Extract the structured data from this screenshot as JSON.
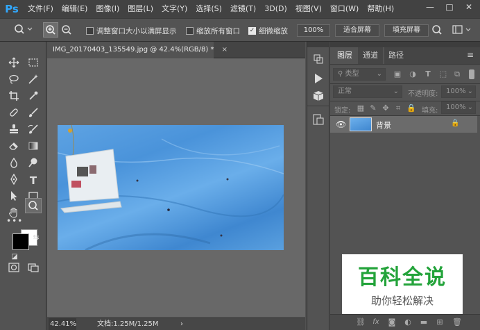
{
  "app": {
    "logo": "Ps"
  },
  "menu": [
    "文件(F)",
    "编辑(E)",
    "图像(I)",
    "图层(L)",
    "文字(Y)",
    "选择(S)",
    "滤镜(T)",
    "3D(D)",
    "视图(V)",
    "窗口(W)",
    "帮助(H)"
  ],
  "window_controls": {
    "minimize": "—",
    "restore": "□",
    "close": "✕"
  },
  "options": {
    "resize_windows": "调整窗口大小以满屏显示",
    "resize_checked": false,
    "zoom_all": "缩放所有窗口",
    "zoom_all_checked": false,
    "scrubby": "细微缩放",
    "scrubby_checked": true,
    "percent": "100%",
    "fit_screen": "适合屏幕",
    "fill_screen": "填充屏幕"
  },
  "document": {
    "tab_title": "IMG_20170403_135549.jpg @ 42.4%(RGB/8) *",
    "close": "×"
  },
  "status": {
    "zoom": "42.41%",
    "doc_info": "文档:1.25M/1.25M",
    "arrow": "›"
  },
  "layers_panel": {
    "tabs": [
      "图层",
      "通道",
      "路径"
    ],
    "filter_kind": "类型",
    "blend_mode": "正常",
    "opacity_label": "不透明度:",
    "opacity_value": "100%",
    "lock_label": "锁定:",
    "fill_label": "填充:",
    "fill_value": "100%",
    "layers": [
      {
        "name": "背景",
        "locked": true,
        "visible": true
      }
    ],
    "footer_icons": [
      "link-icon",
      "fx-icon",
      "mask-icon",
      "adjustment-icon",
      "group-icon",
      "new-layer-icon",
      "trash-icon"
    ]
  },
  "watermark": {
    "title": "百科全说",
    "subtitle": "助你轻松解决"
  },
  "colors": {
    "accent_ps": "#31a8ff",
    "watermark_green": "#23a33a",
    "foreground": "#000000",
    "background": "#ffffff"
  }
}
